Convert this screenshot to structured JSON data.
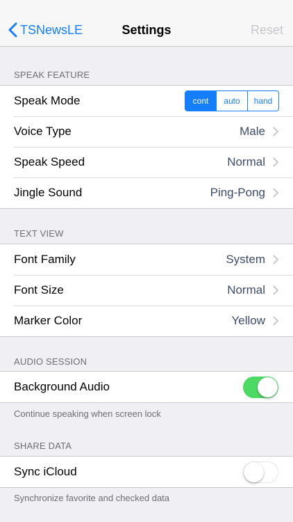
{
  "nav": {
    "back_label": "TSNewsLE",
    "title": "Settings",
    "reset_label": "Reset"
  },
  "sections": {
    "speak": {
      "header": "SPEAK FEATURE",
      "speak_mode": {
        "label": "Speak Mode",
        "options": [
          "cont",
          "auto",
          "hand"
        ],
        "selected": "cont"
      },
      "voice_type": {
        "label": "Voice Type",
        "value": "Male"
      },
      "speak_speed": {
        "label": "Speak Speed",
        "value": "Normal"
      },
      "jingle_sound": {
        "label": "Jingle Sound",
        "value": "Ping-Pong"
      }
    },
    "text_view": {
      "header": "TEXT VIEW",
      "font_family": {
        "label": "Font Family",
        "value": "System"
      },
      "font_size": {
        "label": "Font Size",
        "value": "Normal"
      },
      "marker_color": {
        "label": "Marker Color",
        "value": "Yellow"
      }
    },
    "audio": {
      "header": "AUDIO SESSION",
      "background_audio": {
        "label": "Background Audio",
        "on": true
      },
      "footer": "Continue speaking when screen lock"
    },
    "share": {
      "header": "SHARE DATA",
      "sync_icloud": {
        "label": "Sync iCloud",
        "on": false
      },
      "footer": "Synchronize favorite and checked data"
    }
  },
  "colors": {
    "accent": "#157efb",
    "toggle_on": "#4cd964",
    "value_text": "#3c4b6b",
    "background": "#efeff4"
  },
  "icons": {
    "back": "chevron-left-icon",
    "disclosure": "chevron-right-icon"
  }
}
